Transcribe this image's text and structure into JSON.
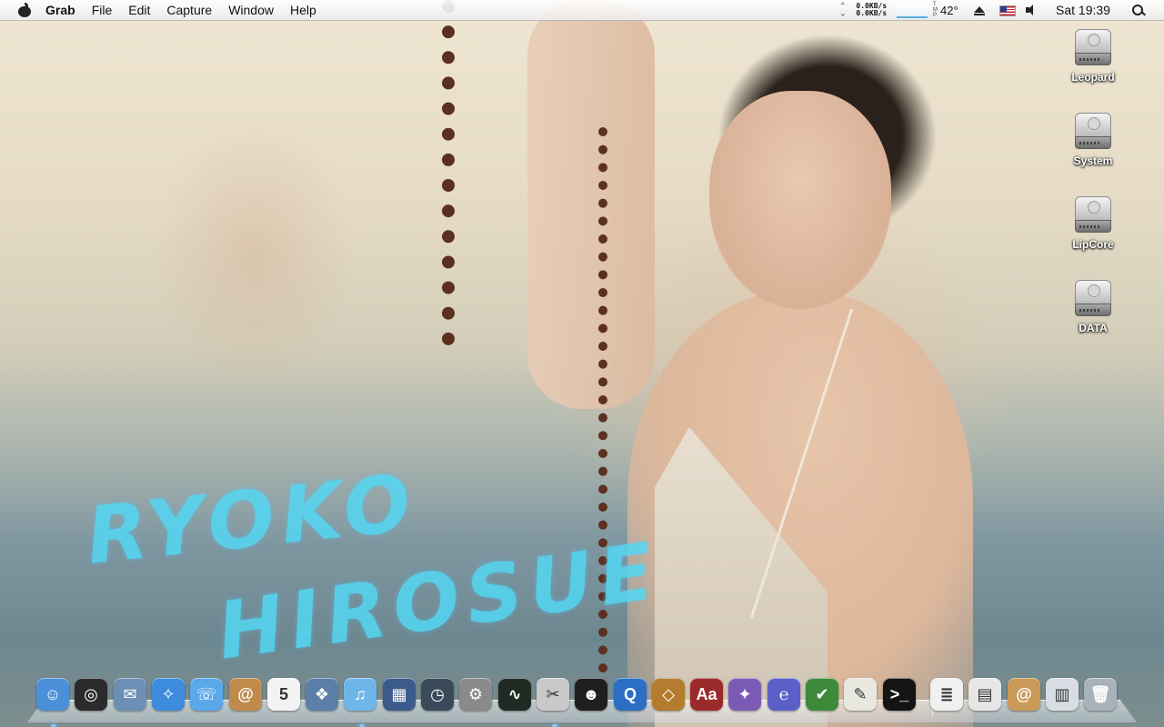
{
  "menubar": {
    "app_name": "Grab",
    "menus": [
      "File",
      "Edit",
      "Capture",
      "Window",
      "Help"
    ],
    "network": {
      "up": "0.0KB/s",
      "down": "0.0KB/s"
    },
    "temperature": {
      "label_t": "T",
      "label_m": "M",
      "label_p": "P",
      "value": "42°"
    },
    "clock": "Sat 19:39"
  },
  "desktop": {
    "drives": [
      "Leopard",
      "System",
      "LipCore",
      "DATA"
    ]
  },
  "wallpaper": {
    "line1": "RYOKO",
    "line2": "HIROSUE"
  },
  "dock": {
    "items": [
      {
        "name": "finder-icon",
        "glyph": "☺",
        "bg": "#4a8fd8"
      },
      {
        "name": "dashboard-icon",
        "glyph": "◎",
        "bg": "#2b2b2b"
      },
      {
        "name": "mail-icon",
        "glyph": "✉",
        "bg": "#6d8fb5"
      },
      {
        "name": "safari-icon",
        "glyph": "✧",
        "bg": "#3c8bdc"
      },
      {
        "name": "ichat-icon",
        "glyph": "☏",
        "bg": "#5aa8ea"
      },
      {
        "name": "address-book-icon",
        "glyph": "@",
        "bg": "#c08a4a"
      },
      {
        "name": "ical-icon",
        "glyph": "5",
        "bg": "#f3f3f3"
      },
      {
        "name": "iphoto-icon",
        "glyph": "❖",
        "bg": "#5b7fa8"
      },
      {
        "name": "itunes-icon",
        "glyph": "♫",
        "bg": "#6fb6e8"
      },
      {
        "name": "spaces-icon",
        "glyph": "▦",
        "bg": "#3b5b8a"
      },
      {
        "name": "time-machine-icon",
        "glyph": "◷",
        "bg": "#3a4a5a"
      },
      {
        "name": "system-preferences-icon",
        "glyph": "⚙",
        "bg": "#8a8a8a"
      },
      {
        "name": "activity-monitor-icon",
        "glyph": "∿",
        "bg": "#1e2a22"
      },
      {
        "name": "script-editor-icon",
        "glyph": "✂",
        "bg": "#c9c9c9"
      },
      {
        "name": "qq-icon",
        "glyph": "☻",
        "bg": "#1f1f1f"
      },
      {
        "name": "quicktime-icon",
        "glyph": "Q",
        "bg": "#2a6fc4"
      },
      {
        "name": "dosbox-icon",
        "glyph": "◇",
        "bg": "#b57b2e"
      },
      {
        "name": "dictionary-icon",
        "glyph": "Aa",
        "bg": "#9b2a2a"
      },
      {
        "name": "xcode-icon",
        "glyph": "✦",
        "bg": "#7a5ab5"
      },
      {
        "name": "emacs-icon",
        "glyph": "℮",
        "bg": "#5a60c8"
      },
      {
        "name": "vim-icon",
        "glyph": "✔",
        "bg": "#3d8a3a"
      },
      {
        "name": "textedit-icon",
        "glyph": "✎",
        "bg": "#e8e8e0"
      },
      {
        "name": "terminal-icon",
        "glyph": ">_",
        "bg": "#141414"
      },
      {
        "name": "script-document-icon",
        "glyph": "≣",
        "bg": "#f0f0f0"
      },
      {
        "name": "documents-stack-icon",
        "glyph": "▤",
        "bg": "#e6e6e6"
      },
      {
        "name": "mail-downloads-stack-icon",
        "glyph": "@",
        "bg": "#c99a58"
      },
      {
        "name": "applications-stack-icon",
        "glyph": "▥",
        "bg": "#d8dde3"
      },
      {
        "name": "trash-icon",
        "glyph": "🗑",
        "bg": "#a9b2bb"
      }
    ]
  }
}
